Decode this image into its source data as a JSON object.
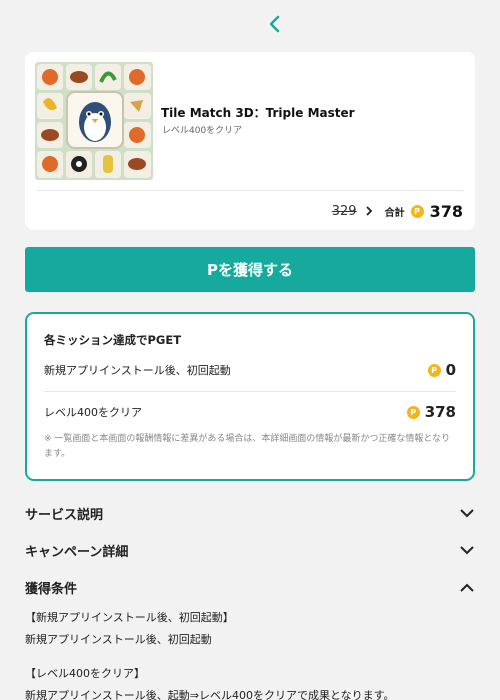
{
  "colors": {
    "accent": "#16aa9e",
    "coin": "#f2b51e",
    "background": "#f2f2f2"
  },
  "app": {
    "title": "Tile Match 3D：Triple Master",
    "subtitle": "レベル400をクリア",
    "old_price": "329",
    "total_label": "合計",
    "total_value": "378"
  },
  "cta_label": "Pを獲得する",
  "mission": {
    "title": "各ミッション達成でPGET",
    "items": [
      {
        "label": "新規アプリインストール後、初回起動",
        "value": "0"
      },
      {
        "label": "レベル400をクリア",
        "value": "378"
      }
    ],
    "note": "※ 一覧画面と本画面の報酬情報に差異がある場合は、本詳細画面の情報が最新かつ正確な情報となります。"
  },
  "sections": {
    "service": "サービス説明",
    "campaign": "キャンペーン詳細",
    "conditions": "獲得条件"
  },
  "conditions_body": {
    "h1": "【新規アプリインストール後、初回起動】",
    "t1": "新規アプリインストール後、初回起動",
    "h2": "【レベル400をクリア】",
    "t2": "新規アプリインストール後、起動⇒レベル400をクリアで成果となります。"
  },
  "coin_symbol": "P",
  "icons": [
    "back-chevron-icon",
    "chevron-right-icon",
    "coin-icon",
    "chevron-down-icon",
    "chevron-up-icon"
  ]
}
